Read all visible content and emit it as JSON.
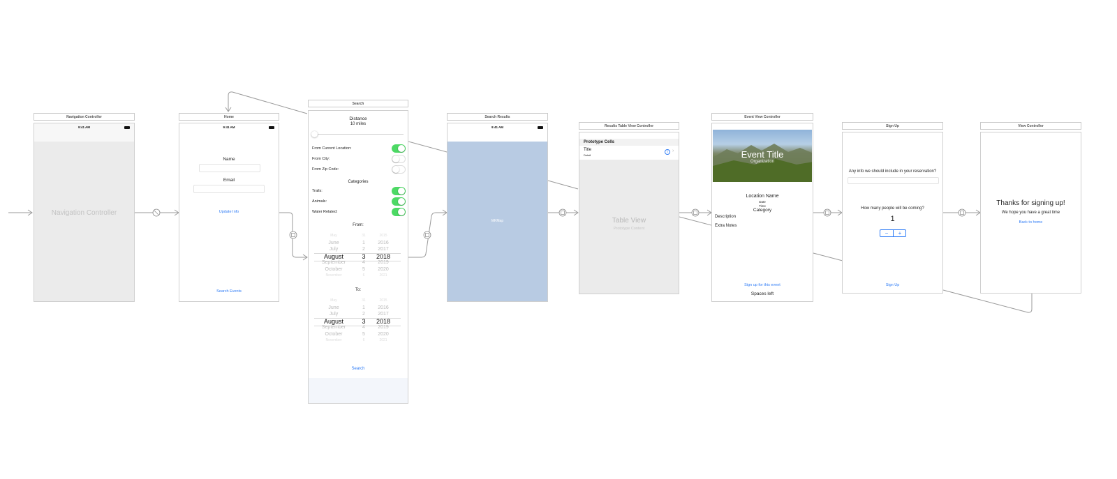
{
  "colors": {
    "canvas": "#ffffff",
    "link": "#2f7cf6",
    "toggle_on": "#4cd964",
    "search_results_fill": "#b8cbe3",
    "placeholder_gray": "#ebebeb",
    "connector": "#9a9a9a"
  },
  "scenes": {
    "navigation_controller": {
      "title": "Navigation Controller",
      "status_time": "9:41 AM",
      "placeholder_label": "Navigation Controller"
    },
    "home": {
      "title": "Home",
      "status_time": "9:41 AM",
      "name_label": "Name",
      "email_label": "Email",
      "update_info": "Update Info",
      "search_events": "Search Events"
    },
    "search": {
      "title": "Search",
      "distance_label": "Distance",
      "distance_value": "10 miles",
      "distance_slider_fraction": 0.0,
      "toggles": [
        {
          "label": "From Current Location:",
          "on": true
        },
        {
          "label": "From City:",
          "on": false
        },
        {
          "label": "From Zip Code:",
          "on": false
        }
      ],
      "categories_label": "Categories",
      "category_toggles": [
        {
          "label": "Trails:",
          "on": true
        },
        {
          "label": "Animals:",
          "on": true
        },
        {
          "label": "Water Related:",
          "on": true
        }
      ],
      "from_label": "From:",
      "to_label": "To:",
      "picker": {
        "months": [
          "May",
          "June",
          "July",
          "August",
          "September",
          "October",
          "November"
        ],
        "days": [
          "31",
          "1",
          "2",
          "3",
          "4",
          "5",
          "6"
        ],
        "years": [
          "2015",
          "2016",
          "2017",
          "2018",
          "2019",
          "2020",
          "2021"
        ]
      },
      "search_button": "Search"
    },
    "search_results": {
      "title": "Search Results",
      "status_time": "9:41 AM",
      "content_label": "MKMap"
    },
    "results_table": {
      "title": "Results Table View Controller",
      "prototype_cells_header": "Prototype Cells",
      "cell_title": "Title",
      "cell_detail": "Detail",
      "table_view_label": "Table View",
      "prototype_content_label": "Prototype Content"
    },
    "event_view": {
      "title": "Event View Controller",
      "event_title": "Event Title",
      "organization": "Organization",
      "location_name": "Location Name",
      "date": "Date",
      "time": "Time",
      "category": "Category",
      "description": "Description",
      "extra_notes": "Extra Notes",
      "sign_up_link": "Sign up for this event",
      "spaces_left": "Spaces left"
    },
    "sign_up": {
      "title": "Sign Up",
      "question1": "Any info we should include in your reservation?",
      "question2": "How many people will be coming?",
      "count": "1",
      "minus": "−",
      "plus": "+",
      "sign_up_button": "Sign Up"
    },
    "view_controller": {
      "title": "View Controller",
      "thanks": "Thanks for signing up!",
      "subtitle": "We hope you have a great time",
      "back_home": "Back to home"
    }
  }
}
